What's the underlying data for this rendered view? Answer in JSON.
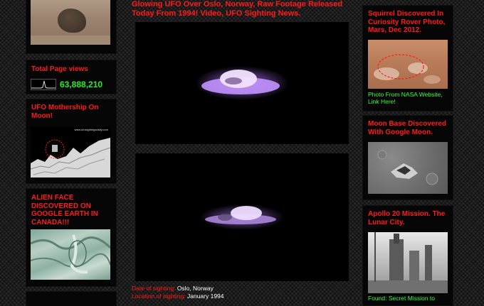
{
  "left_sidebar": {
    "views_widget": {
      "title": "Total Page views",
      "count": "63,888,210"
    },
    "mothership_widget": {
      "title": "UFO Mothership On Moon!",
      "site_watermark": "www.ufosightingsdaily.com"
    },
    "alien_face_widget": {
      "title": "ALIEN FACE DISCOVERED ON GOOGLE EARTH IN CANADA!!!"
    }
  },
  "main": {
    "post_title": "Glowing UFO Over Oslo, Norway, Raw Footage Released Today From 1994! Video, UFO Sighting News.",
    "meta": [
      {
        "label": "Date of sighting:",
        "value": "Oslo, Norway"
      },
      {
        "label": "Location of sighting:",
        "value": "January 1994"
      }
    ]
  },
  "right_sidebar": {
    "squirrel_widget": {
      "title": "Squirrel Discovered In Curiosity Rover Photo, Mars, Dec 2012.",
      "link": "Photo From NASA Website, Link Here!"
    },
    "moon_base_widget": {
      "title": "Moon Base Discovered With Google Moon."
    },
    "apollo_widget": {
      "title": "Apollo 20 Mission. The Lunar City.",
      "link": "Found: Secret Mission to"
    }
  },
  "colors": {
    "title_red": "#ff1a1a",
    "link_green": "#33ff33",
    "counter_green": "#22ee22",
    "page_bg": "#2a2a2a",
    "ufo_glow": "#b478ff"
  }
}
